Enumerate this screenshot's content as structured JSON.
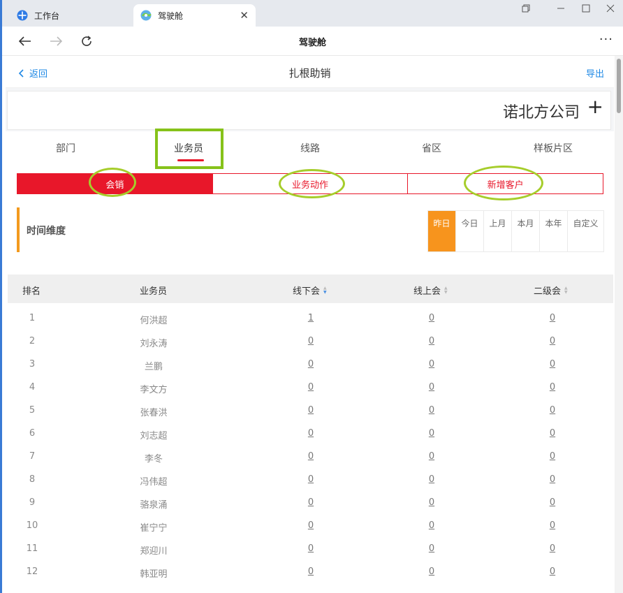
{
  "browser": {
    "tabs": [
      {
        "label": "工作台",
        "icon": "workbench-icon"
      },
      {
        "label": "驾驶舱",
        "icon": "cockpit-icon"
      }
    ],
    "nav_title": "驾驶舱"
  },
  "header": {
    "back_label": "返回",
    "title": "扎根助销",
    "export_label": "导出"
  },
  "company": {
    "name": "诺北方公司"
  },
  "dimension_tabs": [
    "部门",
    "业务员",
    "线路",
    "省区",
    "样板片区"
  ],
  "active_dimension": "业务员",
  "segments": [
    "会销",
    "业务动作",
    "新增客户"
  ],
  "active_segment": "会销",
  "time": {
    "label": "时间维度",
    "options": [
      "昨日",
      "今日",
      "上月",
      "本月",
      "本年",
      "自定义"
    ],
    "active": "昨日"
  },
  "table": {
    "headers": [
      "排名",
      "业务员",
      "线下会",
      "线上会",
      "二级会"
    ],
    "rows": [
      {
        "rank": "1",
        "name": "何洪超",
        "offline": "1",
        "online": "0",
        "second": "0"
      },
      {
        "rank": "2",
        "name": "刘永涛",
        "offline": "0",
        "online": "0",
        "second": "0"
      },
      {
        "rank": "3",
        "name": "兰鹏",
        "offline": "0",
        "online": "0",
        "second": "0"
      },
      {
        "rank": "4",
        "name": "李文方",
        "offline": "0",
        "online": "0",
        "second": "0"
      },
      {
        "rank": "5",
        "name": "张春洪",
        "offline": "0",
        "online": "0",
        "second": "0"
      },
      {
        "rank": "6",
        "name": "刘志超",
        "offline": "0",
        "online": "0",
        "second": "0"
      },
      {
        "rank": "7",
        "name": "李冬",
        "offline": "0",
        "online": "0",
        "second": "0"
      },
      {
        "rank": "8",
        "name": "冯伟超",
        "offline": "0",
        "online": "0",
        "second": "0"
      },
      {
        "rank": "9",
        "name": "骆泉涌",
        "offline": "0",
        "online": "0",
        "second": "0"
      },
      {
        "rank": "10",
        "name": "崔宁宁",
        "offline": "0",
        "online": "0",
        "second": "0"
      },
      {
        "rank": "11",
        "name": "郑迎川",
        "offline": "0",
        "online": "0",
        "second": "0"
      },
      {
        "rank": "12",
        "name": "韩亚明",
        "offline": "0",
        "online": "0",
        "second": "0"
      }
    ]
  },
  "colors": {
    "accent_red": "#e8172a",
    "link_blue": "#1e88e5",
    "time_orange": "#f7941d",
    "annotation_green": "#86c21a"
  }
}
